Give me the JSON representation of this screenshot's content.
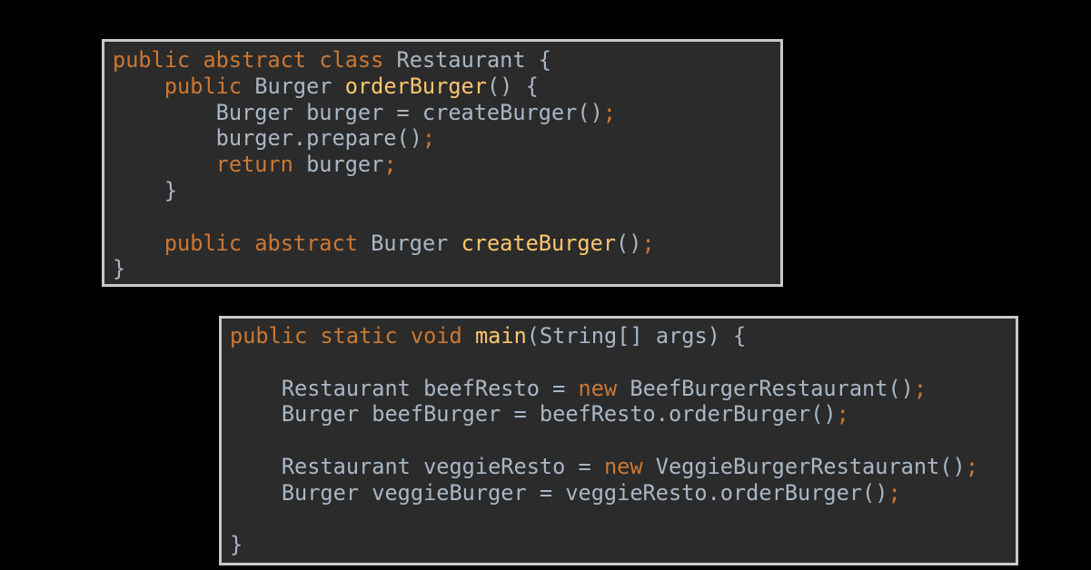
{
  "colors": {
    "background": "#000000",
    "panel_background": "#2b2b2b",
    "panel_border": "#c9c9c9",
    "keyword": "#cc7832",
    "method_declaration": "#ffc66d",
    "plain_text": "#a9b7c6"
  },
  "code_panels": [
    {
      "name": "restaurant-class",
      "lines": [
        [
          [
            "kw",
            "public"
          ],
          [
            "tx",
            " "
          ],
          [
            "kw",
            "abstract"
          ],
          [
            "tx",
            " "
          ],
          [
            "kw",
            "class"
          ],
          [
            "tx",
            " Restaurant {"
          ]
        ],
        [
          [
            "tx",
            "    "
          ],
          [
            "kw",
            "public"
          ],
          [
            "tx",
            " Burger "
          ],
          [
            "fn",
            "orderBurger"
          ],
          [
            "tx",
            "() {"
          ]
        ],
        [
          [
            "tx",
            "        Burger burger = createBurger()"
          ],
          [
            "kw",
            ";"
          ]
        ],
        [
          [
            "tx",
            "        burger.prepare()"
          ],
          [
            "kw",
            ";"
          ]
        ],
        [
          [
            "tx",
            "        "
          ],
          [
            "kw",
            "return"
          ],
          [
            "tx",
            " burger"
          ],
          [
            "kw",
            ";"
          ]
        ],
        [
          [
            "tx",
            "    }"
          ]
        ],
        [],
        [
          [
            "tx",
            "    "
          ],
          [
            "kw",
            "public"
          ],
          [
            "tx",
            " "
          ],
          [
            "kw",
            "abstract"
          ],
          [
            "tx",
            " Burger "
          ],
          [
            "fn",
            "createBurger"
          ],
          [
            "tx",
            "()"
          ],
          [
            "kw",
            ";"
          ]
        ],
        [
          [
            "tx",
            "}"
          ]
        ]
      ]
    },
    {
      "name": "main-method",
      "lines": [
        [
          [
            "kw",
            "public"
          ],
          [
            "tx",
            " "
          ],
          [
            "kw",
            "static"
          ],
          [
            "tx",
            " "
          ],
          [
            "kw",
            "void"
          ],
          [
            "tx",
            " "
          ],
          [
            "fn",
            "main"
          ],
          [
            "tx",
            "(String[] args) {"
          ]
        ],
        [],
        [
          [
            "tx",
            "    Restaurant beefResto = "
          ],
          [
            "kw",
            "new"
          ],
          [
            "tx",
            " BeefBurgerRestaurant()"
          ],
          [
            "kw",
            ";"
          ]
        ],
        [
          [
            "tx",
            "    Burger beefBurger = beefResto.orderBurger()"
          ],
          [
            "kw",
            ";"
          ]
        ],
        [],
        [
          [
            "tx",
            "    Restaurant veggieResto = "
          ],
          [
            "kw",
            "new"
          ],
          [
            "tx",
            " VeggieBurgerRestaurant()"
          ],
          [
            "kw",
            ";"
          ]
        ],
        [
          [
            "tx",
            "    Burger veggieBurger = veggieResto.orderBurger()"
          ],
          [
            "kw",
            ";"
          ]
        ],
        [],
        [
          [
            "tx",
            "}"
          ]
        ]
      ]
    }
  ]
}
